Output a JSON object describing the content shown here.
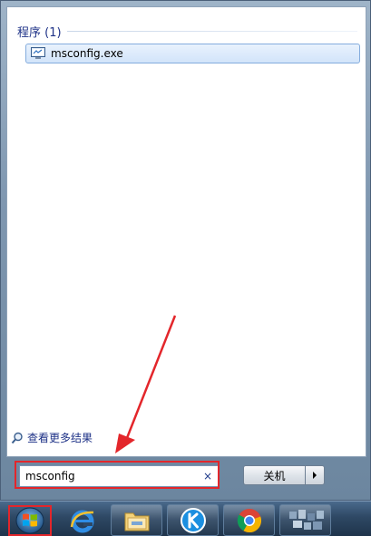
{
  "start_menu": {
    "results": {
      "group_header": "程序 (1)",
      "items": [
        {
          "label": "msconfig.exe",
          "icon": "system-config-icon"
        }
      ]
    },
    "see_more_results": "查看更多结果",
    "search": {
      "value": "msconfig",
      "clear_symbol": "×"
    },
    "shutdown": {
      "label": "关机"
    }
  },
  "taskbar": {
    "items": [
      {
        "name": "start-orb",
        "icon": "windows-logo-icon"
      },
      {
        "name": "internet-explorer",
        "icon": "internet-explorer-icon"
      },
      {
        "name": "file-explorer",
        "icon": "folder-icon"
      },
      {
        "name": "kugou",
        "icon": "kugou-k-icon"
      },
      {
        "name": "chrome",
        "icon": "chrome-icon"
      },
      {
        "name": "blurred-app",
        "icon": "blurred-app-icon"
      }
    ]
  },
  "colors": {
    "highlight_red": "#e3262b",
    "header_blue": "#1e3287",
    "selection_blue": "#84acdd"
  }
}
